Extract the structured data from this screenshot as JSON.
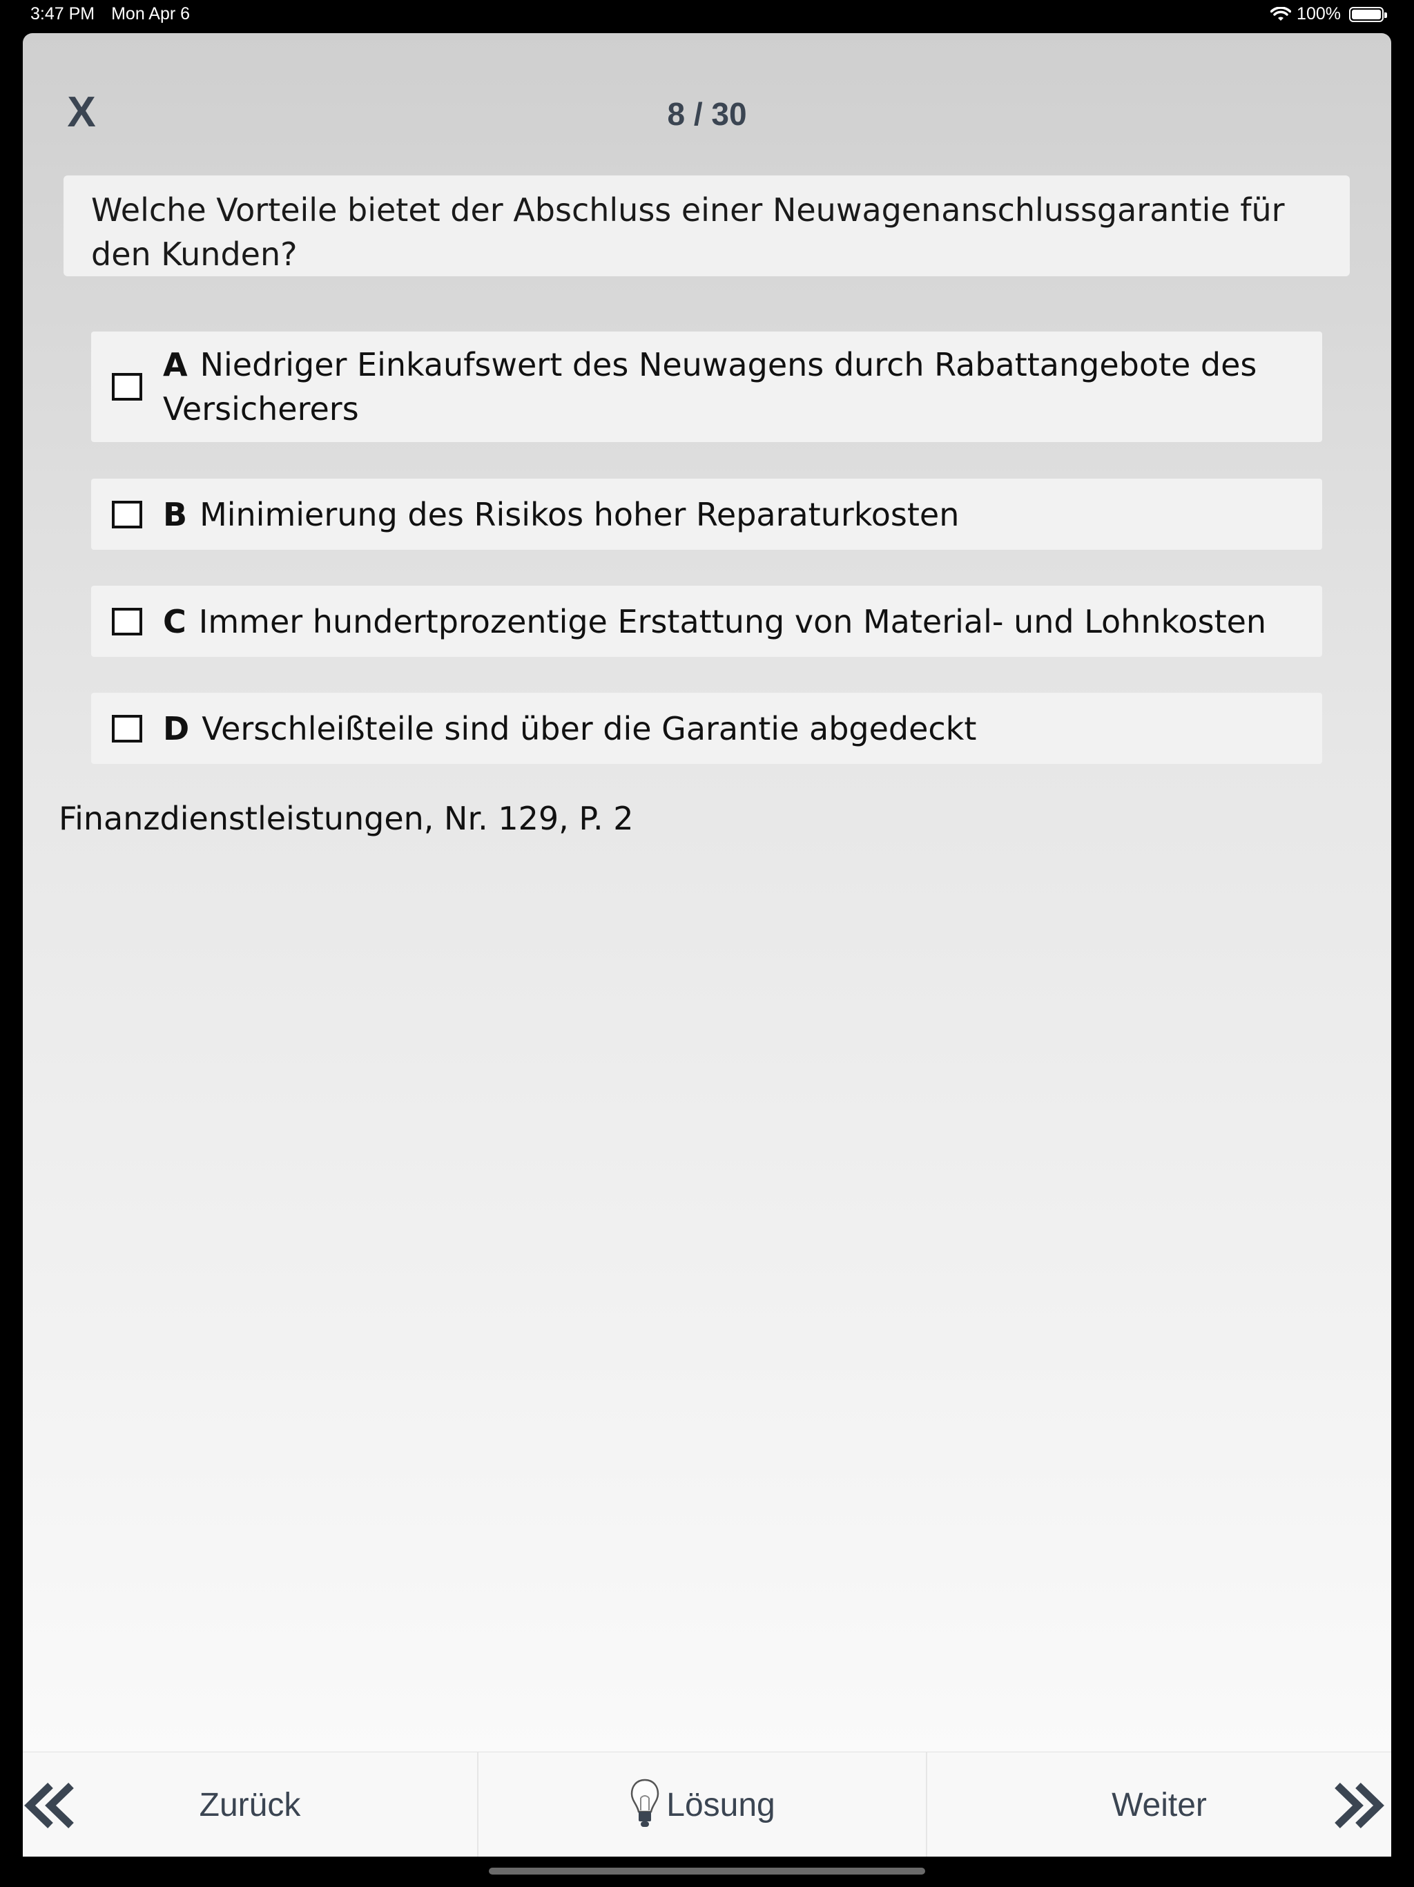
{
  "status_bar": {
    "time": "3:47 PM",
    "date": "Mon Apr 6",
    "battery": "100%"
  },
  "header": {
    "close_label": "X",
    "counter": "8 / 30"
  },
  "question": {
    "text": "Welche Vorteile bietet der Abschluss einer Neuwagenanschlussgarantie für den Kunden?"
  },
  "answers": [
    {
      "letter": "A",
      "text": "Niedriger Einkaufswert des Neuwagens durch Rabattangebote des Versicherers",
      "checked": false
    },
    {
      "letter": "B",
      "text": "Minimierung des Risikos hoher Reparaturkosten",
      "checked": false
    },
    {
      "letter": "C",
      "text": "Immer hundertprozentige Erstattung von Material- und Lohnkosten",
      "checked": false
    },
    {
      "letter": "D",
      "text": "Verschleißteile sind über die Garantie abgedeckt",
      "checked": false
    }
  ],
  "source": "Finanzdienstleistungen, Nr. 129, P. 2",
  "footer": {
    "back_label": "Zurück",
    "solution_label": "Lösung",
    "next_label": "Weiter"
  },
  "colors": {
    "accent": "#3b4552",
    "card": "#f2f2f2"
  },
  "icons": [
    "wifi-icon",
    "battery-icon",
    "double-chevron-left-icon",
    "lightbulb-icon",
    "double-chevron-right-icon"
  ]
}
